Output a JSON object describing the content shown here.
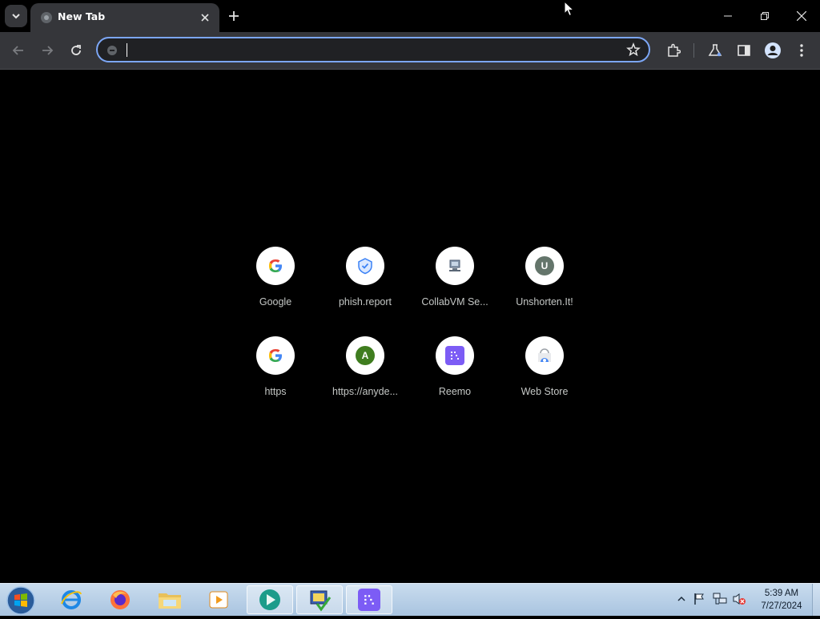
{
  "browser": {
    "tab": {
      "title": "New Tab",
      "favicon": "chrome-globe-icon"
    },
    "new_tab_icon": "plus-icon",
    "tab_search_icon": "chevron-down-icon",
    "window_controls": [
      "minimize-icon",
      "restore-icon",
      "close-icon"
    ]
  },
  "toolbar": {
    "back_icon": "arrow-left-icon",
    "forward_icon": "arrow-right-icon",
    "reload_icon": "reload-icon",
    "omnibox": {
      "value": "",
      "placeholder": ""
    },
    "right_icons": [
      "bookmark-star-icon",
      "extensions-icon",
      "labs-flask-icon",
      "side-panel-icon",
      "profile-icon",
      "menu-dots-icon"
    ]
  },
  "shortcuts": [
    {
      "label": "Google",
      "icon": "google-g-icon"
    },
    {
      "label": "phish.report",
      "icon": "phish-report-icon"
    },
    {
      "label": "CollabVM Se...",
      "icon": "collabvm-icon"
    },
    {
      "label": "Unshorten.It!",
      "icon": "letter-u-icon",
      "letter": "U"
    },
    {
      "label": "https",
      "icon": "google-g-icon"
    },
    {
      "label": "https://anyde...",
      "icon": "letter-a-icon",
      "letter": "A"
    },
    {
      "label": "Reemo",
      "icon": "reemo-icon"
    },
    {
      "label": "Web Store",
      "icon": "web-store-icon"
    }
  ],
  "taskbar": {
    "apps": [
      "internet-explorer-icon",
      "firefox-icon",
      "file-explorer-icon",
      "media-player-icon",
      "collabvm-client-icon",
      "task-app-icon",
      "reemo-app-icon"
    ],
    "tray_icons": [
      "show-hidden-icons-arrow",
      "action-center-flag-icon",
      "network-icon",
      "volume-muted-icon"
    ],
    "clock": {
      "time": "5:39 AM",
      "date": "7/27/2024"
    }
  },
  "colors": {
    "accent": "#7ca6f5",
    "toolbar": "#35363a",
    "taskbar": "#b7cfe7"
  }
}
